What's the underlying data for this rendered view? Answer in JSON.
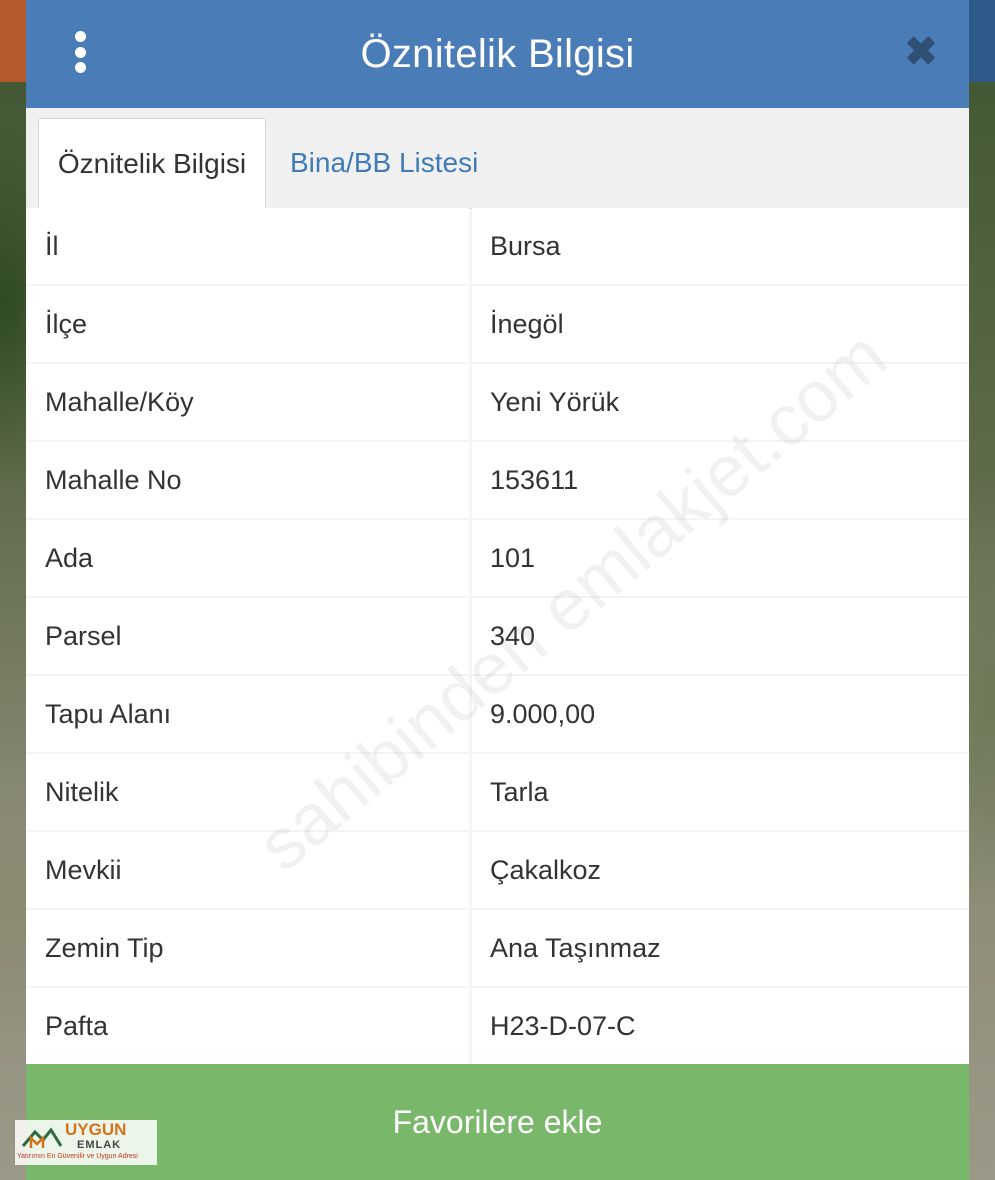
{
  "header": {
    "title": "Öznitelik Bilgisi",
    "menu_icon": "more-vertical-icon",
    "close_icon": "close-icon"
  },
  "tabs": [
    {
      "label": "Öznitelik Bilgisi",
      "active": true
    },
    {
      "label": "Bina/BB Listesi",
      "active": false
    }
  ],
  "attributes": [
    {
      "key": "İl",
      "value": "Bursa"
    },
    {
      "key": "İlçe",
      "value": "İnegöl"
    },
    {
      "key": "Mahalle/Köy",
      "value": "Yeni Yörük"
    },
    {
      "key": "Mahalle No",
      "value": "153611"
    },
    {
      "key": "Ada",
      "value": "101"
    },
    {
      "key": "Parsel",
      "value": "340"
    },
    {
      "key": "Tapu Alanı",
      "value": "9.000,00"
    },
    {
      "key": "Nitelik",
      "value": "Tarla"
    },
    {
      "key": "Mevkii",
      "value": "Çakalkoz"
    },
    {
      "key": "Zemin Tip",
      "value": "Ana Taşınmaz"
    },
    {
      "key": "Pafta",
      "value": "H23-D-07-C"
    }
  ],
  "footer": {
    "favorite_label": "Favorilere ekle"
  },
  "logo": {
    "name": "UYGUN",
    "sub": "EMLAK",
    "tagline": "Yatırımın En Güvenilir ve Uygun Adresi"
  },
  "watermark": "sahibinden emlakjet.com",
  "colors": {
    "header": "#4a7db8",
    "button": "#79b86a",
    "tab_link": "#3f7bb5"
  }
}
